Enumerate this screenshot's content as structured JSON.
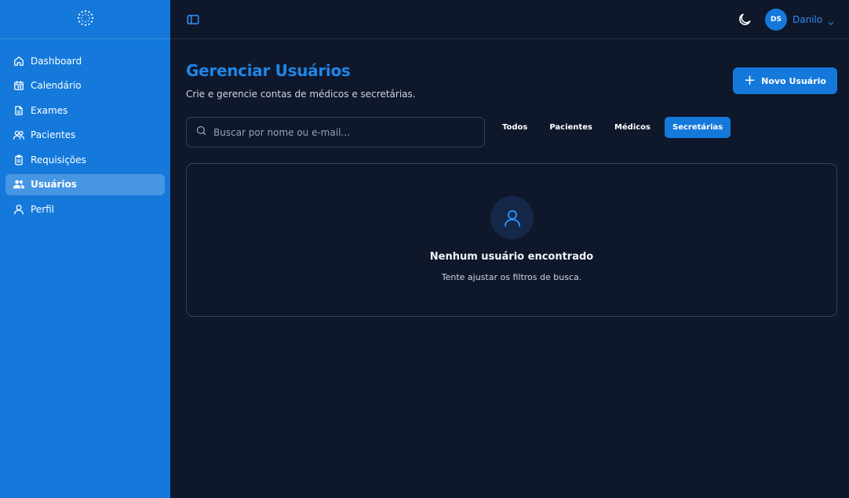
{
  "sidebar": {
    "logo_icon": "spinner-dots-logo",
    "items": [
      {
        "label": "Dashboard",
        "icon": "home-icon",
        "active": false
      },
      {
        "label": "Calendário",
        "icon": "calendar-icon",
        "active": false
      },
      {
        "label": "Exames",
        "icon": "file-icon",
        "active": false
      },
      {
        "label": "Pacientes",
        "icon": "users-icon",
        "active": false
      },
      {
        "label": "Requisições",
        "icon": "clipboard-icon",
        "active": false
      },
      {
        "label": "Usuários",
        "icon": "users-group-icon",
        "active": true
      },
      {
        "label": "Perfil",
        "icon": "user-icon",
        "active": false
      }
    ]
  },
  "topbar": {
    "sidebar_toggle_icon": "panel-left-icon",
    "theme_icon": "moon-icon",
    "user": {
      "initials": "DS",
      "name": "Danilo"
    }
  },
  "main": {
    "title": "Gerenciar Usuários",
    "subtitle": "Crie e gerencie contas de médicos e secretárias.",
    "new_button_label": "Novo Usuário",
    "search": {
      "placeholder": "Buscar por nome ou e-mail...",
      "value": ""
    },
    "filters": [
      {
        "label": "Todos",
        "active": false
      },
      {
        "label": "Pacientes",
        "active": false
      },
      {
        "label": "Médicos",
        "active": false
      },
      {
        "label": "Secretárias",
        "active": true
      }
    ],
    "empty_state": {
      "title": "Nenhum usuário encontrado",
      "subtitle": "Tente ajustar os filtros de busca."
    }
  },
  "colors": {
    "accent": "#1479db",
    "background": "#0f172a",
    "sidebar_bg": "#1479db"
  }
}
